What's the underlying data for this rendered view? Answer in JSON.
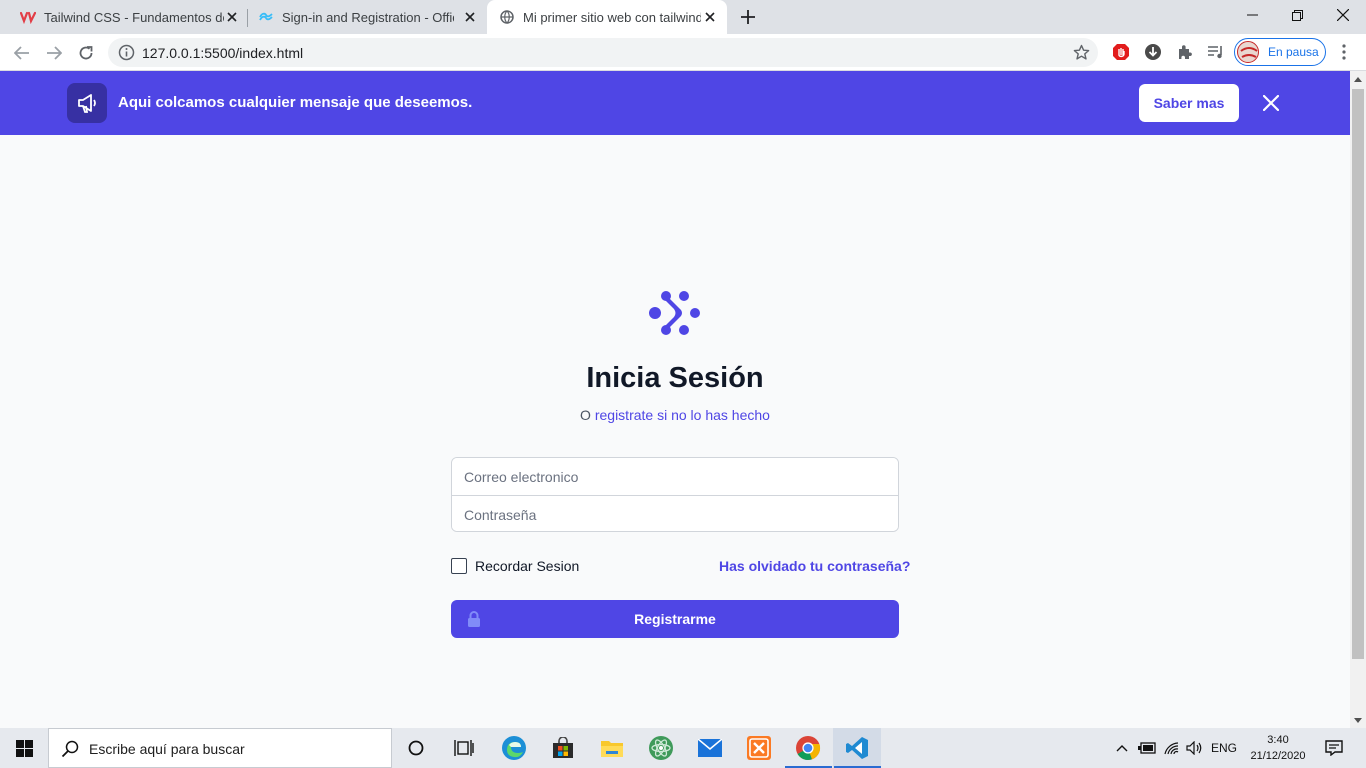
{
  "browser": {
    "tabs": [
      {
        "title": "Tailwind CSS - Fundamentos des",
        "favicon": "udemy-icon",
        "active": false
      },
      {
        "title": "Sign-in and Registration - Officia",
        "favicon": "tailwind-icon",
        "active": false
      },
      {
        "title": "Mi primer sitio web con tailwind",
        "favicon": "globe-icon",
        "active": true
      }
    ],
    "url": "127.0.0.1:5500/index.html",
    "profile_label": "En pausa"
  },
  "banner": {
    "message": "Aqui colcamos cualquier mensaje que deseemos.",
    "button_label": "Saber mas",
    "color": "#4f46e5"
  },
  "login": {
    "title": "Inicia Sesión",
    "subtitle_prefix": "O ",
    "subtitle_link": "registrate si no lo has hecho",
    "email_placeholder": "Correo electronico",
    "password_placeholder": "Contraseña",
    "remember_label": "Recordar Sesion",
    "forgot_label": "Has olvidado tu contraseña?",
    "submit_label": "Registrarme",
    "accent": "#4f46e5"
  },
  "taskbar": {
    "search_placeholder": "Escribe aquí para buscar",
    "language": "ENG",
    "time": "3:40",
    "date": "21/12/2020"
  }
}
